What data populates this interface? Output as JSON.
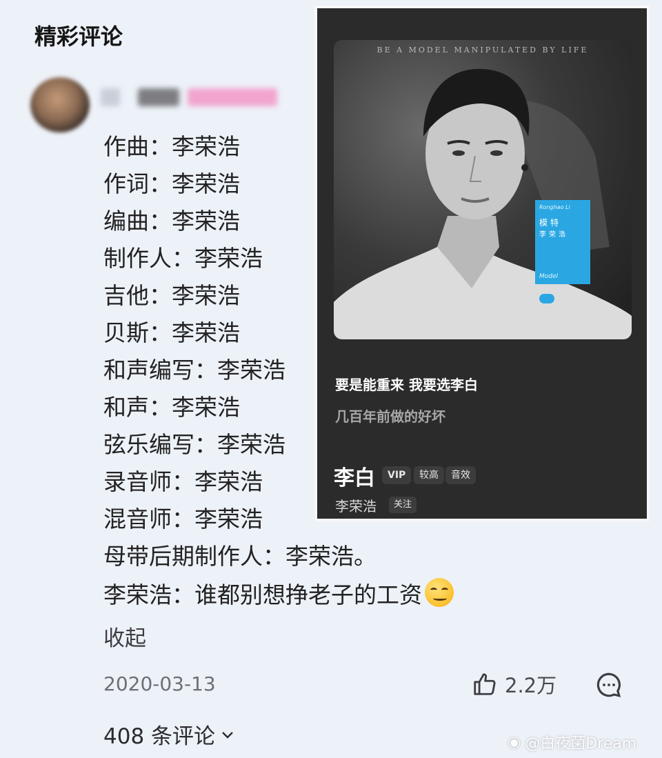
{
  "section_title": "精彩评论",
  "comment": {
    "lines": [
      "作曲：李荣浩",
      "作词：李荣浩",
      "编曲：李荣浩",
      "制作人：李荣浩",
      "吉他：李荣浩",
      "贝斯：李荣浩",
      "和声编写：李荣浩",
      "和声：李荣浩",
      "弦乐编写：李荣浩",
      "录音师：李荣浩",
      "混音师：李荣浩",
      "母带后期制作人：李荣浩。",
      "李荣浩：谁都别想挣老子的工资"
    ],
    "emoji": "smirk-emoji",
    "collapse_label": "收起",
    "date": "2020-03-13",
    "likes": "2.2万",
    "comment_count_label": "408 条评论"
  },
  "card": {
    "cover_tagline": "BE A MODEL MANIPULATED BY LIFE",
    "album_tag": {
      "name_en": "Ronghao Li",
      "album_cn": "模特",
      "artist_cn": "李荣浩",
      "album_en": "Model"
    },
    "lyric_line_1": "要是能重来 我要选李白",
    "lyric_line_2": "几百年前做的好坏",
    "song_title": "李白",
    "badges": [
      "VIP",
      "较高",
      "音效"
    ],
    "artist": "李荣浩",
    "follow_label": "关注"
  },
  "watermark": "@白夜菌Dream",
  "colors": {
    "page_background": "#edf1f8",
    "card_background": "#2b2b2b",
    "album_tag_blue": "#2aa7e2"
  }
}
